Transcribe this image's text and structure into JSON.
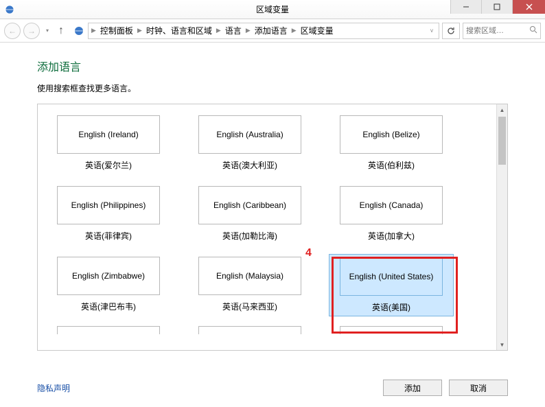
{
  "window": {
    "title": "区域变量"
  },
  "breadcrumb": {
    "items": [
      "控制面板",
      "时钟、语言和区域",
      "语言",
      "添加语言",
      "区域变量"
    ]
  },
  "search": {
    "placeholder": "搜索区域…"
  },
  "page": {
    "heading": "添加语言",
    "subhead": "使用搜索框查找更多语言。"
  },
  "langs": [
    {
      "en": "English (Ireland)",
      "cn": "英语(爱尔兰)",
      "selected": false
    },
    {
      "en": "English (Australia)",
      "cn": "英语(澳大利亚)",
      "selected": false
    },
    {
      "en": "English (Belize)",
      "cn": "英语(伯利兹)",
      "selected": false
    },
    {
      "en": "English (Philippines)",
      "cn": "英语(菲律宾)",
      "selected": false
    },
    {
      "en": "English (Caribbean)",
      "cn": "英语(加勒比海)",
      "selected": false
    },
    {
      "en": "English (Canada)",
      "cn": "英语(加拿大)",
      "selected": false
    },
    {
      "en": "English (Zimbabwe)",
      "cn": "英语(津巴布韦)",
      "selected": false
    },
    {
      "en": "English (Malaysia)",
      "cn": "英语(马来西亚)",
      "selected": false
    },
    {
      "en": "English (United States)",
      "cn": "英语(美国)",
      "selected": true
    }
  ],
  "annotation": {
    "label": "4"
  },
  "footer": {
    "privacy": "隐私声明",
    "add": "添加",
    "cancel": "取消"
  }
}
